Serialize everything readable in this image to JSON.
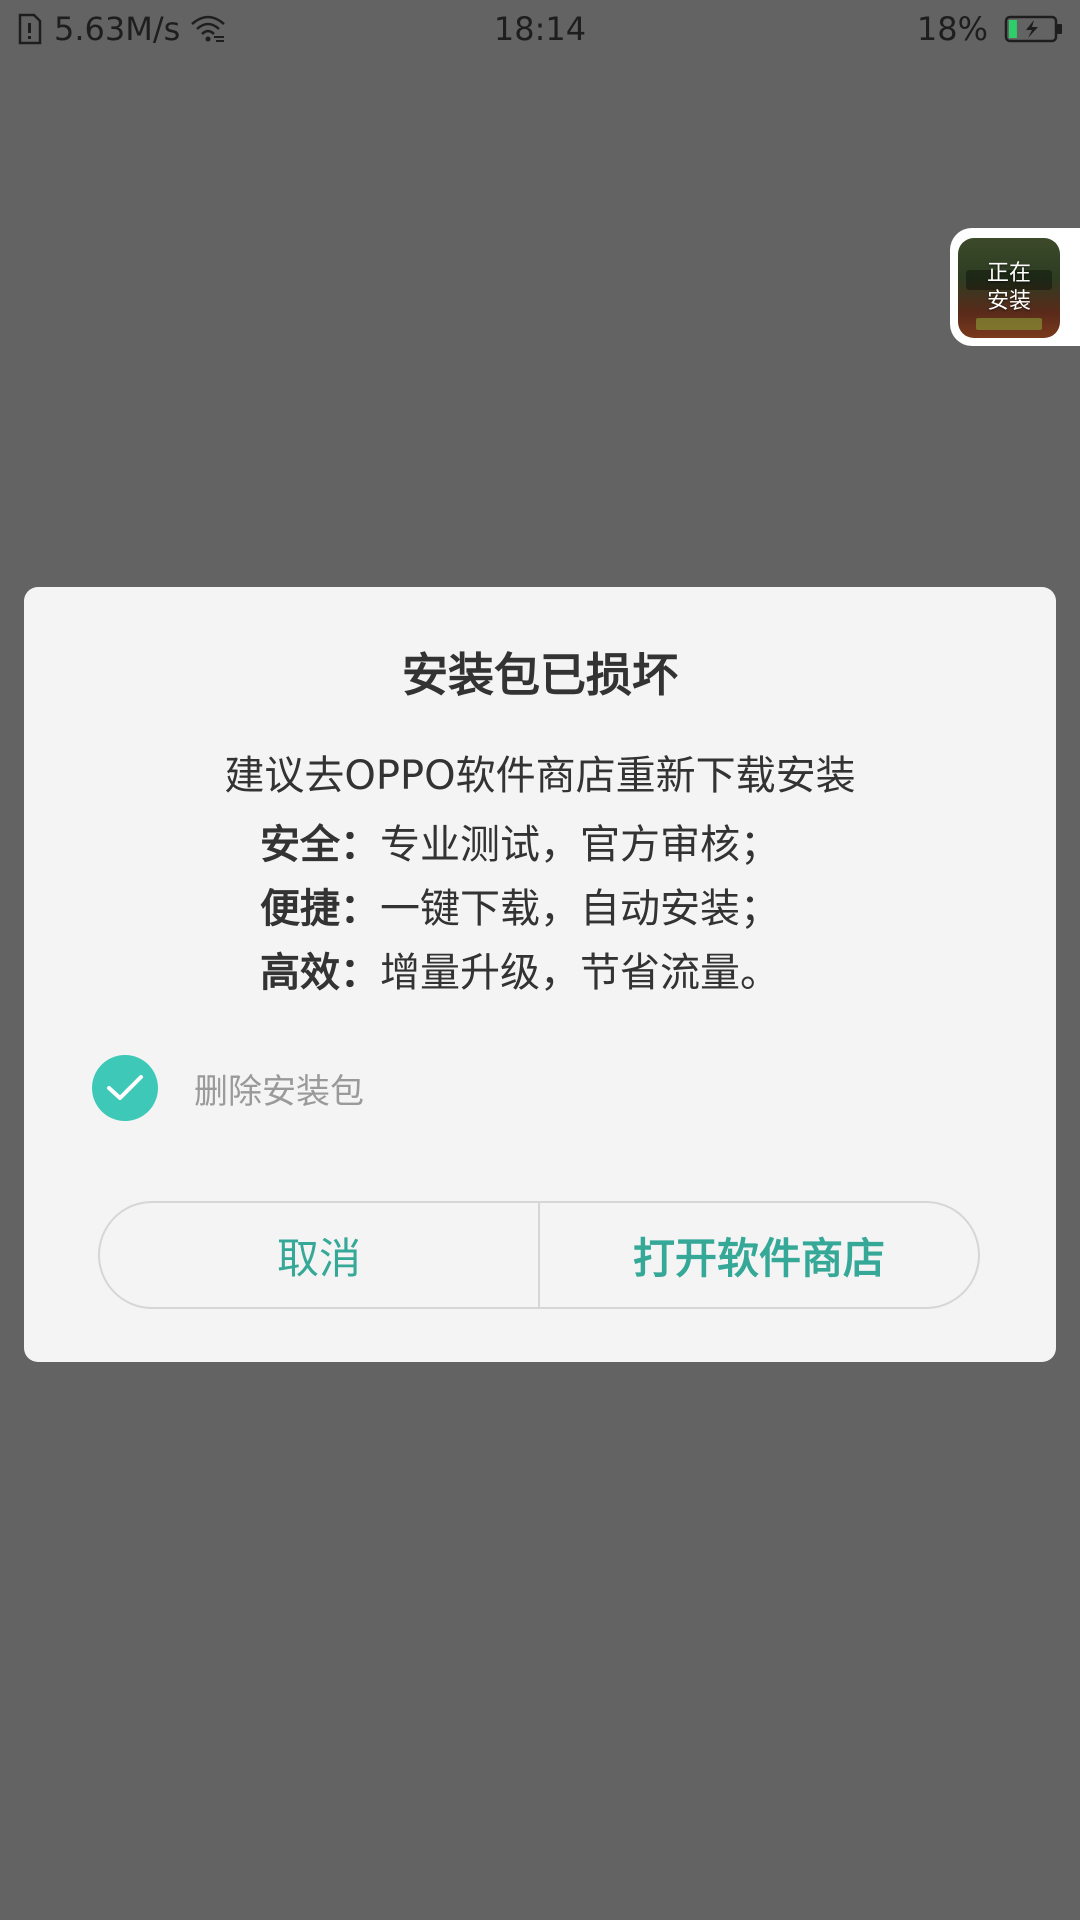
{
  "status_bar": {
    "network_speed": "5.63M/s",
    "time": "18:14",
    "battery_percent": "18%",
    "battery_level": 0.18,
    "icons": [
      "sim-card-icon",
      "wifi-icon",
      "battery-charging-icon"
    ]
  },
  "install_bubble": {
    "line1": "正在",
    "line2": "安装"
  },
  "dialog": {
    "title": "安装包已损坏",
    "intro": "建议去OPPO软件商店重新下载安装",
    "features": [
      {
        "key": "安全：",
        "value": "专业测试，官方审核；"
      },
      {
        "key": "便捷：",
        "value": "一键下载，自动安装；"
      },
      {
        "key": "高效：",
        "value": "增量升级，节省流量。"
      }
    ],
    "delete_package": {
      "label": "删除安装包",
      "checked": true
    },
    "buttons": {
      "cancel": "取消",
      "open_store": "打开软件商店"
    }
  },
  "colors": {
    "accent": "#35a897",
    "check": "#3dc8b8",
    "overlay": "#636363",
    "dialog_bg": "#f4f4f4"
  }
}
